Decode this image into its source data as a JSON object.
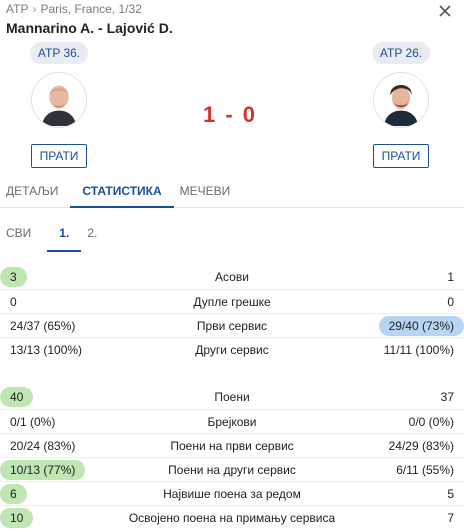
{
  "breadcrumb": {
    "tour": "ATP",
    "event": "Paris, France, 1/32"
  },
  "match_title": "Mannarino A. - Lajović D.",
  "home": {
    "rank": "ATP 36.",
    "follow_label": "ПРАТИ"
  },
  "away": {
    "rank": "ATP 26.",
    "follow_label": "ПРАТИ"
  },
  "score": "1 - 0",
  "tabs": [
    "ДЕТАЉИ",
    "СТАТИСТИКА",
    "МЕЧЕВИ"
  ],
  "subtabs": [
    "СВИ",
    "1.",
    "2."
  ],
  "stats_group_1": [
    {
      "home": "3",
      "label": "Асови",
      "away": "1",
      "highlight": "home-green"
    },
    {
      "home": "0",
      "label": "Дупле грешке",
      "away": "0",
      "highlight": ""
    },
    {
      "home": "24/37 (65%)",
      "label": "Први сервис",
      "away": "29/40 (73%)",
      "highlight": "away-blue"
    },
    {
      "home": "13/13 (100%)",
      "label": "Други сервис",
      "away": "11/11 (100%)",
      "highlight": ""
    }
  ],
  "stats_group_2": [
    {
      "home": "40",
      "label": "Поени",
      "away": "37",
      "highlight": "home-green"
    },
    {
      "home": "0/1 (0%)",
      "label": "Брејкови",
      "away": "0/0 (0%)",
      "highlight": ""
    },
    {
      "home": "20/24 (83%)",
      "label": "Поени на први сервис",
      "away": "24/29 (83%)",
      "highlight": ""
    },
    {
      "home": "10/13 (77%)",
      "label": "Поени на други сервис",
      "away": "6/11 (55%)",
      "highlight": "home-green"
    },
    {
      "home": "6",
      "label": "Највише поена за редом",
      "away": "5",
      "highlight": "home-green"
    },
    {
      "home": "10",
      "label": "Освојено поена на примању сервиса",
      "away": "7",
      "highlight": "home-green"
    }
  ],
  "colors": {
    "accent": "#1a4f9c",
    "score": "#d0342c",
    "highlight_green": "#bfe6b3",
    "highlight_blue": "#b7d5f2"
  },
  "icons": {
    "close": "close-icon",
    "breadcrumb_sep": "chevron-right-icon"
  }
}
